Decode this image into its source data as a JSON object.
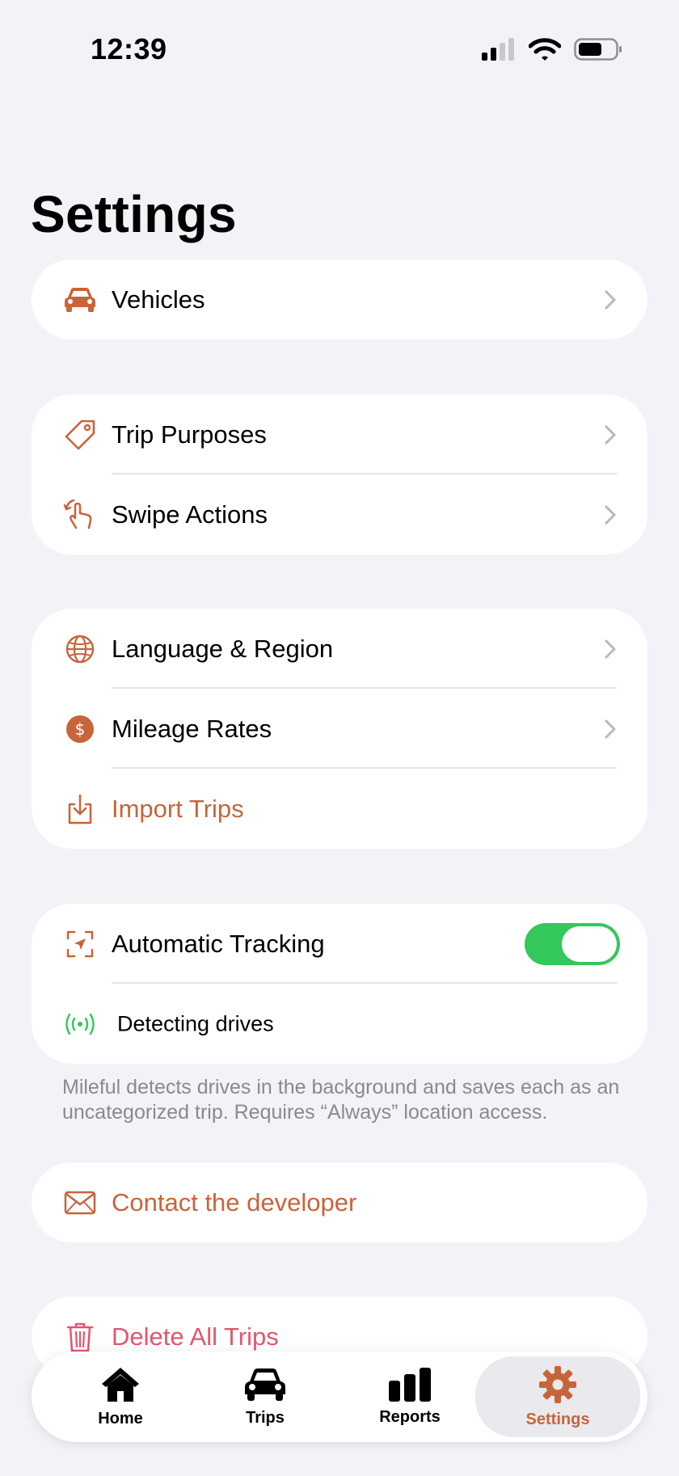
{
  "status_bar": {
    "time": "12:39"
  },
  "page": {
    "title": "Settings"
  },
  "sections": {
    "vehicles": {
      "label": "Vehicles"
    },
    "trip_purposes": {
      "label": "Trip Purposes"
    },
    "swipe_actions": {
      "label": "Swipe Actions"
    },
    "language_region": {
      "label": "Language & Region"
    },
    "mileage_rates": {
      "label": "Mileage Rates"
    },
    "import_trips": {
      "label": "Import Trips"
    },
    "automatic_tracking": {
      "label": "Automatic Tracking",
      "enabled": true
    },
    "detecting_drives": {
      "label": "Detecting drives"
    },
    "tracking_footnote": "Mileful detects drives in the background and saves each as an uncategorized trip. Requires “Always” location access.",
    "contact": {
      "label": "Contact the developer"
    },
    "delete": {
      "label": "Delete All Trips"
    }
  },
  "tab_bar": {
    "tabs": [
      {
        "label": "Home",
        "icon": "house-icon",
        "active": false
      },
      {
        "label": "Trips",
        "icon": "car-icon",
        "active": false
      },
      {
        "label": "Reports",
        "icon": "bar-chart-icon",
        "active": false
      },
      {
        "label": "Settings",
        "icon": "gear-icon",
        "active": true
      }
    ]
  },
  "colors": {
    "accent": "#c8643a",
    "toggle_on": "#34c759",
    "danger": "#e2566e",
    "background": "#f2f2f7"
  }
}
